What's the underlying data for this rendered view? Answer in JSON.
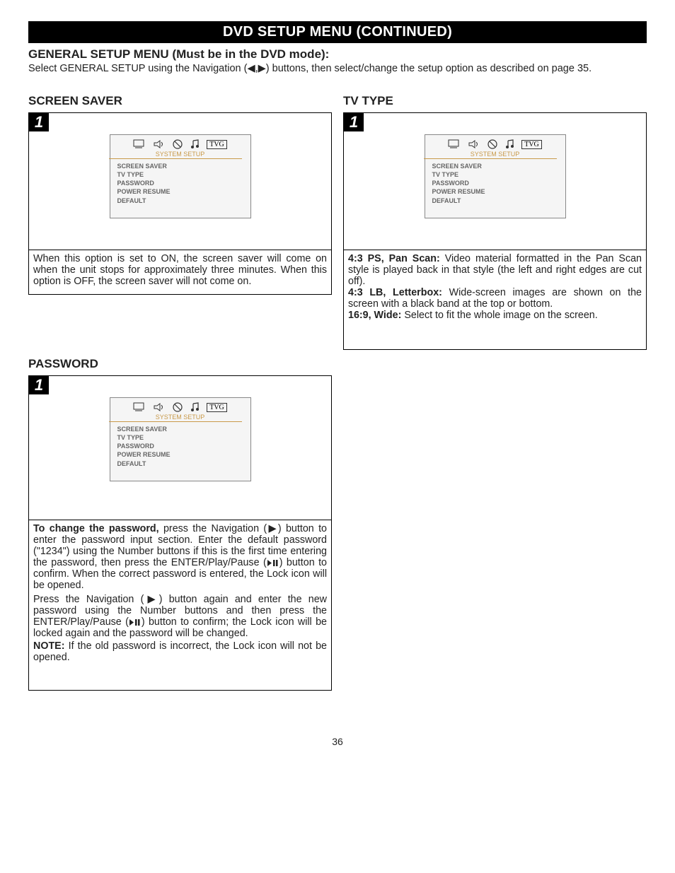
{
  "title": "DVD SETUP MENU (CONTINUED)",
  "subtitle": "GENERAL SETUP MENU (Must be in the DVD mode):",
  "instruction": "Select GENERAL SETUP using the Navigation (◀,▶) buttons, then select/change the setup option as described on page 35.",
  "sections": {
    "screen_saver": {
      "heading": "SCREEN SAVER",
      "step": "1",
      "body": "When this option is set to ON, the screen saver will come on when the unit stops for approximately three minutes. When this option is OFF, the screen saver will not come on."
    },
    "tv_type": {
      "heading": "TV TYPE",
      "step": "1",
      "body_parts": {
        "l1b": "4:3 PS, Pan Scan:",
        "l1": " Video material formatted in the Pan Scan style is played back in that style (the left and right edges are cut off).",
        "l2b": "4:3 LB, Letterbox:",
        "l2": " Wide-screen images are shown on the screen with a black band at the top or bottom.",
        "l3b": "16:9, Wide:",
        "l3": " Select to fit the whole image on the screen."
      }
    },
    "password": {
      "heading": "PASSWORD",
      "step": "1",
      "body_parts": {
        "p1b": "To change the password,",
        "p1": " press the Navigation (▶) button to enter the password input section. Enter the default password (\"1234\") using the Number buttons if this is the first time entering the password, then press the ENTER/Play/Pause (",
        "p1_after": ") button to confirm. When the correct password is entered, the Lock icon will be opened.",
        "p2": "Press the Navigation (▶) button again and enter the new password using the Number buttons and then press the ENTER/Play/Pause (",
        "p2_after": ") button to confirm; the Lock icon will be locked again and the password will be changed.",
        "noteb": "NOTE:",
        "note": " If the old password is incorrect, the Lock icon will not be opened."
      }
    }
  },
  "osd": {
    "system_setup": "SYSTEM SETUP",
    "tvg": "TVG",
    "items": {
      "a": "SCREEN SAVER",
      "b": "TV TYPE",
      "c": "PASSWORD",
      "d": "POWER RESUME",
      "e": "DEFAULT"
    }
  },
  "page_number": "36"
}
